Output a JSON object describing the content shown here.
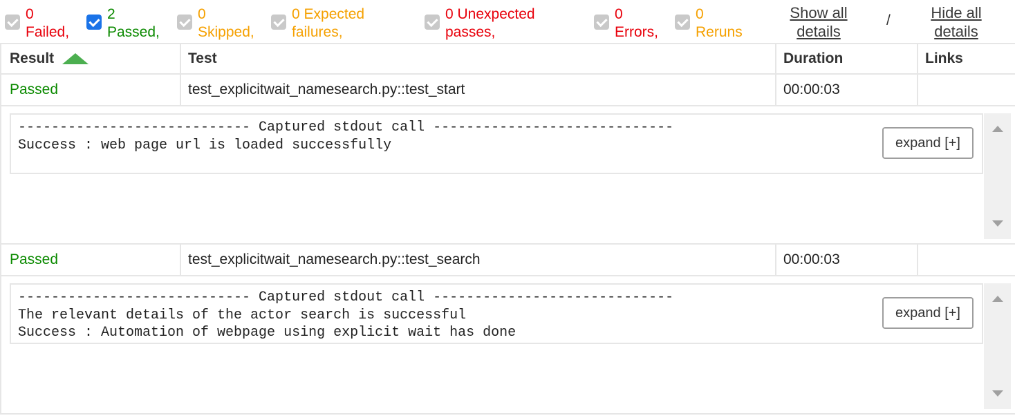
{
  "filters": [
    {
      "count": "0",
      "label": "Failed,",
      "checked": false,
      "color": "#e8000b"
    },
    {
      "count": "2",
      "label": "Passed,",
      "checked": true,
      "color": "#0b8a00"
    },
    {
      "count": "0",
      "label": "Skipped,",
      "checked": false,
      "color": "#f5a000"
    },
    {
      "line1": "0 Expected",
      "line2": "failures,",
      "checked": false,
      "color": "#f5a000"
    },
    {
      "line1": "0 Unexpected",
      "line2": "passes,",
      "checked": false,
      "color": "#e8000b"
    },
    {
      "count": "0",
      "label": "Errors,",
      "checked": false,
      "color": "#e8000b"
    },
    {
      "count": "0",
      "label": "Reruns",
      "checked": false,
      "color": "#f5a000"
    }
  ],
  "links": {
    "show_line1": "Show all",
    "show_line2": "details",
    "separator": "/",
    "hide_line1": "Hide all",
    "hide_line2": "details"
  },
  "table": {
    "headers": {
      "result": "Result",
      "test": "Test",
      "duration": "Duration",
      "links": "Links"
    },
    "rows": [
      {
        "result": "Passed",
        "test": "test_explicitwait_namesearch.py::test_start",
        "duration": "00:00:03",
        "links": "",
        "log": "---------------------------- Captured stdout call -----------------------------\nSuccess : web page url is loaded successfully",
        "expand_label": "expand [+]"
      },
      {
        "result": "Passed",
        "test": "test_explicitwait_namesearch.py::test_search",
        "duration": "00:00:03",
        "links": "",
        "log": "---------------------------- Captured stdout call -----------------------------\nThe relevant details of the actor search is successful\nSuccess : Automation of webpage using explicit wait has done",
        "expand_label": "expand [+]"
      }
    ]
  }
}
